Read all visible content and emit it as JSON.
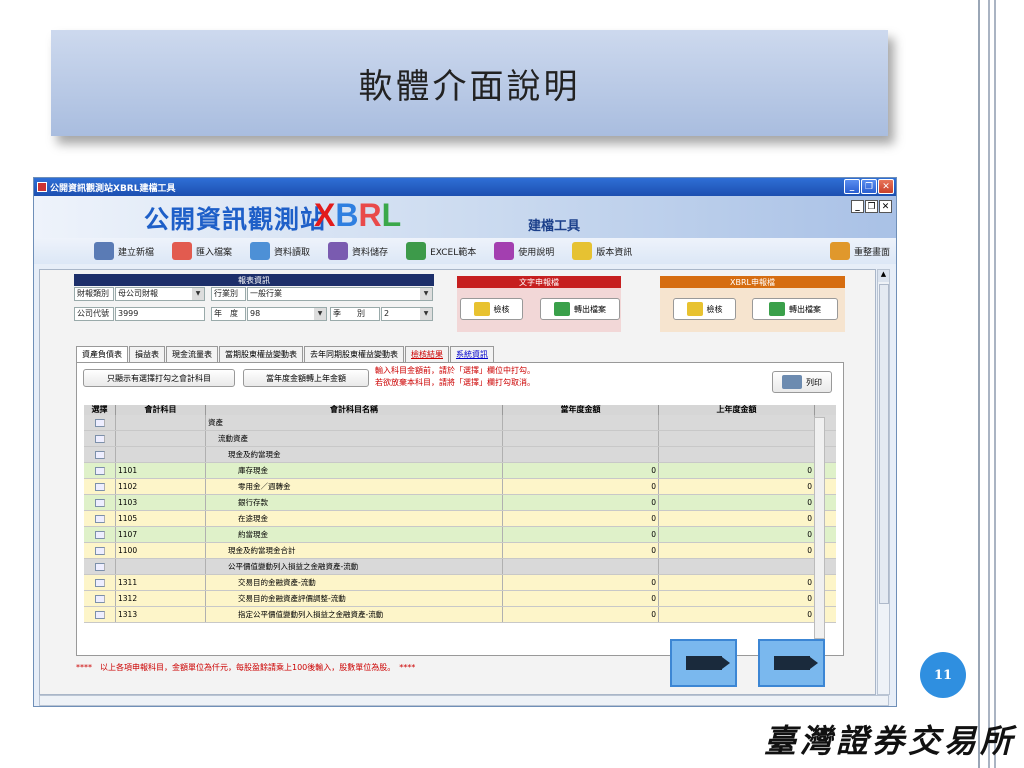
{
  "slide": {
    "title": "軟體介面說明",
    "page_number": "11",
    "footer": "臺灣證券交易所"
  },
  "window": {
    "title": "公開資訊觀測站XBRL建檔工具",
    "brand": "公開資訊觀測站",
    "brand_xbrl": "XBRL",
    "subtitle": "建檔工具"
  },
  "toolbar": [
    {
      "label": "建立新檔",
      "icon": "new-file-icon",
      "color": "#5a7bb5"
    },
    {
      "label": "匯入檔案",
      "icon": "folder-icon",
      "color": "#e25b4f"
    },
    {
      "label": "資料讀取",
      "icon": "search-icon",
      "color": "#4d90d6"
    },
    {
      "label": "資料儲存",
      "icon": "save-gear-icon",
      "color": "#7a5bb0"
    },
    {
      "label": "EXCEL範本",
      "icon": "excel-icon",
      "color": "#3d9a4a"
    },
    {
      "label": "使用說明",
      "icon": "help-icon",
      "color": "#a33fb0"
    },
    {
      "label": "版本資訊",
      "icon": "info-icon",
      "color": "#e6c232"
    },
    {
      "label": "重整畫面",
      "icon": "refresh-icon",
      "color": "#e0982c"
    }
  ],
  "report_info": {
    "group_title": "報表資訊",
    "report_type_label": "財報類別",
    "report_type_value": "母公司財報",
    "industry_label": "行業別",
    "industry_value": "一般行業",
    "company_label": "公司代號",
    "company_value": "3999",
    "year_label": "年　度",
    "year_value": "98",
    "season_label": "季　　別",
    "season_value": "2"
  },
  "text_report": {
    "group_title": "文字申報檔",
    "check_label": "檢核",
    "export_label": "轉出檔案"
  },
  "xbrl_report": {
    "group_title": "XBRL申報檔",
    "check_label": "檢核",
    "export_label": "轉出檔案"
  },
  "tabs": [
    "資產負債表",
    "損益表",
    "現金流量表",
    "當期股東權益變動表",
    "去年同期股東權益變動表",
    "檢核結果",
    "系統資訊"
  ],
  "panel": {
    "show_selected_label": "只顯示有選擇打勾之會計科目",
    "transfer_label": "當年度金額轉上年金額",
    "note_line1": "輸入科目金額前，請於「選擇」欄位中打勾。",
    "note_line2": "若欲放棄本科目，請將「選擇」欄打勾取消。",
    "print_label": "列印"
  },
  "table": {
    "headers": [
      "選擇",
      "會計科目",
      "會計科目名稱",
      "當年度金額",
      "上年度金額"
    ],
    "rows": [
      {
        "code": "",
        "name": "資產",
        "cur": "",
        "prev": "",
        "style": "gray",
        "indent": 0
      },
      {
        "code": "",
        "name": "流動資產",
        "cur": "",
        "prev": "",
        "style": "gray",
        "indent": 1
      },
      {
        "code": "",
        "name": "現金及約當現金",
        "cur": "",
        "prev": "",
        "style": "gray",
        "indent": 2
      },
      {
        "code": "1101",
        "name": "庫存現金",
        "cur": "0",
        "prev": "0",
        "style": "green",
        "indent": 3
      },
      {
        "code": "1102",
        "name": "零用金／週轉金",
        "cur": "0",
        "prev": "0",
        "style": "yellow",
        "indent": 3
      },
      {
        "code": "1103",
        "name": "銀行存款",
        "cur": "0",
        "prev": "0",
        "style": "green",
        "indent": 3
      },
      {
        "code": "1105",
        "name": "在途現金",
        "cur": "0",
        "prev": "0",
        "style": "yellow",
        "indent": 3
      },
      {
        "code": "1107",
        "name": "約當現金",
        "cur": "0",
        "prev": "0",
        "style": "green",
        "indent": 3
      },
      {
        "code": "1100",
        "name": "現金及約當現金合計",
        "cur": "0",
        "prev": "0",
        "style": "yellow",
        "indent": 2
      },
      {
        "code": "",
        "name": "公平價值變動列入損益之金融資產-流動",
        "cur": "",
        "prev": "",
        "style": "gray",
        "indent": 2
      },
      {
        "code": "1311",
        "name": "交易目的金融資產-流動",
        "cur": "0",
        "prev": "0",
        "style": "yellow",
        "indent": 3
      },
      {
        "code": "1312",
        "name": "交易目的金融資產評價調整-流動",
        "cur": "0",
        "prev": "0",
        "style": "yellow",
        "indent": 3
      },
      {
        "code": "1313",
        "name": "指定公平價值變動列入損益之金融資產-流動",
        "cur": "0",
        "prev": "0",
        "style": "yellow",
        "indent": 3
      }
    ]
  },
  "footnote": "****　以上各項申報科目，金額單位為仟元，每股盈餘請乘上100後輸入，股數單位為股。　****"
}
